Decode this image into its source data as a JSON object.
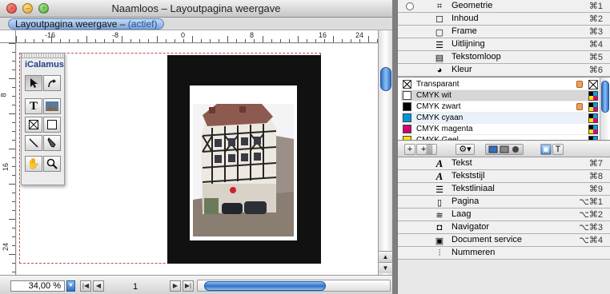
{
  "window": {
    "title": "Naamloos – Layoutpagina weergave",
    "tab_label": "Layoutpagina weergave – ",
    "tab_state": "(actief)"
  },
  "h_ruler": [
    "-16",
    "-8",
    "0",
    "8",
    "16",
    "24"
  ],
  "v_ruler": [
    "8",
    "16",
    "24"
  ],
  "tool_palette": {
    "title": "iCalamus",
    "tools": [
      "pointer-tool",
      "rotate-tool",
      "text-tool",
      "image-tool",
      "frame-tool",
      "rectangle-tool",
      "line-tool",
      "pen-tool",
      "hand-tool",
      "zoom-tool"
    ]
  },
  "statusbar": {
    "zoom": "34,00 %",
    "page": "1"
  },
  "inspector_top": [
    {
      "icon": "geometry-icon",
      "label": "Geometrie",
      "shortcut": "⌘1"
    },
    {
      "icon": "content-icon",
      "label": "Inhoud",
      "shortcut": "⌘2"
    },
    {
      "icon": "frame-icon",
      "label": "Frame",
      "shortcut": "⌘3"
    },
    {
      "icon": "align-icon",
      "label": "Uitlijning",
      "shortcut": "⌘4"
    },
    {
      "icon": "textwrap-icon",
      "label": "Tekstomloop",
      "shortcut": "⌘5"
    },
    {
      "icon": "palette-icon",
      "label": "Kleur",
      "shortcut": "⌘6"
    }
  ],
  "colors": [
    {
      "name": "Transparant",
      "swatch": "transparent",
      "locked": true,
      "mode": "none"
    },
    {
      "name": "CMYK wit",
      "swatch": "#ffffff",
      "locked": false,
      "mode": "cmyk"
    },
    {
      "name": "CMYK zwart",
      "swatch": "#000000",
      "locked": true,
      "mode": "cmyk"
    },
    {
      "name": "CMYK cyaan",
      "swatch": "#0096d6",
      "locked": false,
      "mode": "cmyk"
    },
    {
      "name": "CMYK magenta",
      "swatch": "#d4006e",
      "locked": false,
      "mode": "cmyk"
    },
    {
      "name": "CMYK Geel",
      "swatch": "#ffe600",
      "locked": false,
      "mode": "cmyk"
    }
  ],
  "color_toolbar": [
    "+",
    "+▒",
    "⚙▾",
    "▣",
    "T"
  ],
  "inspector_bottom": [
    {
      "icon": "text-icon",
      "label": "Tekst",
      "shortcut": "⌘7"
    },
    {
      "icon": "textstyle-icon",
      "label": "Tekststijl",
      "shortcut": "⌘8"
    },
    {
      "icon": "textruler-icon",
      "label": "Tekstliniaal",
      "shortcut": "⌘9"
    },
    {
      "icon": "page-icon",
      "label": "Pagina",
      "shortcut": "⌥⌘1"
    },
    {
      "icon": "layer-icon",
      "label": "Laag",
      "shortcut": "⌥⌘2"
    },
    {
      "icon": "navigator-icon",
      "label": "Navigator",
      "shortcut": "⌥⌘3"
    },
    {
      "icon": "document-service-icon",
      "label": "Document service",
      "shortcut": "⌥⌘4"
    },
    {
      "icon": "numbering-icon",
      "label": "Nummeren",
      "shortcut": ""
    }
  ],
  "colors_accent": {
    "selection": "#d6d6d6",
    "scroll": "#2f6fc8"
  }
}
